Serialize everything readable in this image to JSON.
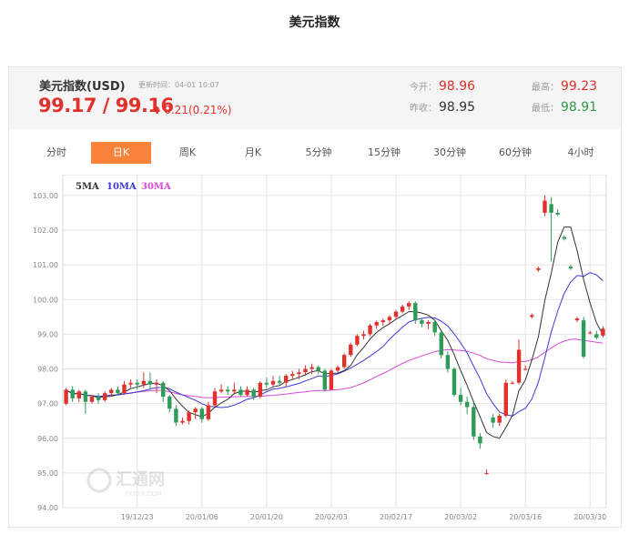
{
  "page": {
    "title": "美元指数"
  },
  "quote": {
    "name": "美元指数(USD)",
    "update_time": "更新时间：04-01 10:07",
    "price": "99.17 / 99.16",
    "change": "0.21(0.21%)",
    "open_label": "今开：",
    "open_value": "98.96",
    "prev_close_label": "昨收：",
    "prev_close_value": "98.95",
    "high_label": "最高：",
    "high_value": "99.23",
    "low_label": "最低：",
    "low_value": "98.91"
  },
  "tabs": [
    {
      "label": "分时",
      "active": false
    },
    {
      "label": "日K",
      "active": true
    },
    {
      "label": "周K",
      "active": false
    },
    {
      "label": "月K",
      "active": false
    },
    {
      "label": "5分钟",
      "active": false
    },
    {
      "label": "15分钟",
      "active": false
    },
    {
      "label": "30分钟",
      "active": false
    },
    {
      "label": "60分钟",
      "active": false
    },
    {
      "label": "4小时",
      "active": false
    }
  ],
  "colors": {
    "up": "#e0312d",
    "down": "#2e9b58",
    "ma5": "#333333",
    "ma10": "#3b3bd6",
    "ma30": "#d64ad6",
    "accent": "#f7823a"
  },
  "watermark": {
    "text": "汇通网",
    "sub": "FX678.COM"
  },
  "chart_data": {
    "type": "candlestick",
    "ylim": [
      94,
      103.6
    ],
    "y_ticks": [
      "103.00",
      "102.00",
      "101.00",
      "100.00",
      "99.00",
      "98.00",
      "97.00",
      "96.00",
      "95.00",
      "94.00"
    ],
    "y_tick_values": [
      103,
      102,
      101,
      100,
      99,
      98,
      97,
      96,
      95,
      94
    ],
    "x_labels": [
      {
        "label": "19/12/23",
        "index": 11
      },
      {
        "label": "20/01/06",
        "index": 21
      },
      {
        "label": "20/01/20",
        "index": 31
      },
      {
        "label": "20/02/03",
        "index": 41
      },
      {
        "label": "20/02/17",
        "index": 51
      },
      {
        "label": "20/03/02",
        "index": 61
      },
      {
        "label": "20/03/16",
        "index": 71
      },
      {
        "label": "20/03/30",
        "index": 81
      }
    ],
    "legend": [
      "5MA",
      "10MA",
      "30MA"
    ],
    "candles": [
      [
        97.0,
        97.4,
        97.45,
        96.95
      ],
      [
        97.4,
        97.15,
        97.5,
        97.05
      ],
      [
        97.15,
        97.35,
        97.4,
        97.05
      ],
      [
        97.35,
        97.05,
        97.4,
        96.7
      ],
      [
        97.05,
        97.2,
        97.25,
        97.0
      ],
      [
        97.2,
        97.1,
        97.3,
        97.0
      ],
      [
        97.1,
        97.3,
        97.35,
        97.05
      ],
      [
        97.3,
        97.4,
        97.45,
        97.2
      ],
      [
        97.4,
        97.3,
        97.5,
        97.25
      ],
      [
        97.3,
        97.55,
        97.65,
        97.25
      ],
      [
        97.55,
        97.6,
        97.7,
        97.45
      ],
      [
        97.6,
        97.55,
        97.7,
        97.4
      ],
      [
        97.55,
        97.65,
        97.9,
        97.45
      ],
      [
        97.65,
        97.55,
        97.9,
        97.4
      ],
      [
        97.55,
        97.6,
        97.7,
        97.3
      ],
      [
        97.6,
        97.2,
        97.65,
        97.05
      ],
      [
        97.2,
        96.85,
        97.25,
        96.75
      ],
      [
        96.85,
        96.45,
        96.95,
        96.35
      ],
      [
        96.45,
        96.5,
        96.6,
        96.4
      ],
      [
        96.5,
        96.75,
        96.8,
        96.4
      ],
      [
        96.75,
        96.85,
        96.9,
        96.55
      ],
      [
        96.85,
        96.55,
        96.9,
        96.45
      ],
      [
        96.55,
        96.95,
        97.05,
        96.5
      ],
      [
        96.95,
        97.35,
        97.45,
        96.9
      ],
      [
        97.35,
        97.4,
        97.55,
        97.3
      ],
      [
        97.4,
        97.35,
        97.5,
        97.25
      ],
      [
        97.35,
        97.4,
        97.6,
        97.3
      ],
      [
        97.4,
        97.25,
        97.5,
        97.2
      ],
      [
        97.25,
        97.4,
        97.5,
        97.2
      ],
      [
        97.4,
        97.2,
        97.45,
        97.1
      ],
      [
        97.2,
        97.6,
        97.65,
        97.15
      ],
      [
        97.6,
        97.55,
        97.75,
        97.45
      ],
      [
        97.55,
        97.65,
        97.8,
        97.5
      ],
      [
        97.65,
        97.6,
        97.8,
        97.55
      ],
      [
        97.6,
        97.8,
        97.85,
        97.5
      ],
      [
        97.8,
        97.85,
        97.95,
        97.7
      ],
      [
        97.85,
        97.9,
        98.0,
        97.7
      ],
      [
        97.9,
        98.0,
        98.1,
        97.8
      ],
      [
        98.0,
        98.05,
        98.15,
        97.85
      ],
      [
        98.05,
        97.95,
        98.1,
        97.85
      ],
      [
        97.95,
        97.4,
        98.0,
        97.35
      ],
      [
        97.4,
        97.95,
        98.0,
        97.4
      ],
      [
        97.95,
        98.05,
        98.1,
        97.9
      ],
      [
        98.05,
        98.4,
        98.45,
        98.0
      ],
      [
        98.4,
        98.7,
        98.75,
        98.35
      ],
      [
        98.7,
        98.95,
        99.0,
        98.65
      ],
      [
        98.95,
        99.0,
        99.1,
        98.85
      ],
      [
        99.0,
        99.25,
        99.3,
        98.95
      ],
      [
        99.25,
        99.35,
        99.4,
        99.15
      ],
      [
        99.35,
        99.4,
        99.45,
        99.25
      ],
      [
        99.4,
        99.5,
        99.55,
        99.3
      ],
      [
        99.5,
        99.65,
        99.7,
        99.45
      ],
      [
        99.65,
        99.8,
        99.85,
        99.6
      ],
      [
        99.8,
        99.9,
        99.95,
        99.7
      ],
      [
        99.9,
        99.4,
        99.95,
        99.3
      ],
      [
        99.4,
        99.3,
        99.45,
        99.2
      ],
      [
        99.3,
        99.35,
        99.4,
        99.15
      ],
      [
        99.35,
        99.05,
        99.4,
        98.95
      ],
      [
        99.05,
        98.4,
        99.1,
        98.3
      ],
      [
        98.4,
        98.0,
        98.5,
        97.9
      ],
      [
        98.0,
        97.25,
        98.05,
        97.2
      ],
      [
        97.25,
        97.05,
        97.45,
        96.95
      ],
      [
        97.05,
        96.9,
        97.2,
        96.7
      ],
      [
        96.9,
        96.05,
        97.05,
        95.95
      ],
      [
        96.05,
        95.85,
        96.15,
        95.7
      ],
      [
        95.0,
        95.0,
        95.1,
        94.95
      ],
      [
        96.6,
        96.45,
        96.7,
        96.3
      ],
      [
        96.45,
        96.65,
        96.7,
        96.35
      ],
      [
        96.65,
        97.6,
        97.7,
        96.6
      ],
      [
        97.6,
        97.6,
        97.65,
        97.55
      ],
      [
        97.6,
        98.55,
        98.85,
        97.55
      ],
      [
        98.0,
        98.0,
        98.1,
        97.95
      ],
      [
        99.5,
        99.55,
        99.6,
        99.45
      ],
      [
        100.85,
        100.9,
        100.95,
        100.8
      ],
      [
        102.5,
        102.85,
        103.0,
        102.4
      ],
      [
        102.75,
        102.5,
        102.95,
        101.1
      ],
      [
        102.5,
        102.45,
        102.6,
        102.4
      ],
      [
        101.8,
        101.75,
        101.85,
        101.7
      ],
      [
        100.95,
        100.9,
        101.0,
        100.85
      ],
      [
        99.4,
        99.45,
        99.5,
        99.35
      ],
      [
        99.4,
        98.35,
        99.5,
        98.3
      ],
      [
        99.05,
        99.05,
        99.1,
        99.0
      ],
      [
        99.0,
        98.9,
        99.1,
        98.85
      ],
      [
        98.96,
        99.16,
        99.23,
        98.91
      ]
    ]
  }
}
